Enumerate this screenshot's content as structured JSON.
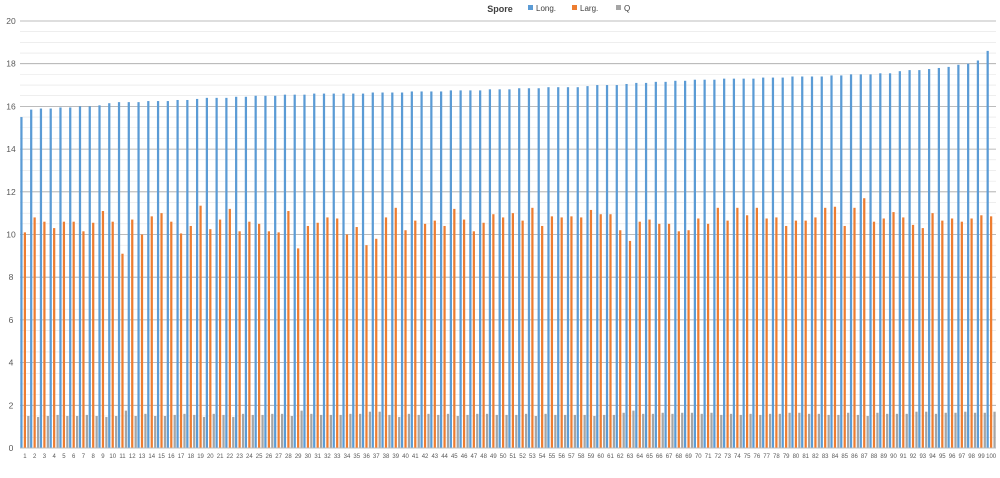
{
  "chart_data": {
    "type": "bar",
    "title": "Spore",
    "xlabel": "",
    "ylabel": "",
    "ylim": [
      0,
      20
    ],
    "yticks": [
      0,
      2,
      4,
      6,
      8,
      10,
      12,
      14,
      16,
      18,
      20
    ],
    "minor_grid_step": 0.5,
    "grid": true,
    "legend_position": "top",
    "categories": [
      "1",
      "2",
      "3",
      "4",
      "5",
      "6",
      "7",
      "8",
      "9",
      "10",
      "11",
      "12",
      "13",
      "14",
      "15",
      "16",
      "17",
      "18",
      "19",
      "20",
      "21",
      "22",
      "23",
      "24",
      "25",
      "26",
      "27",
      "28",
      "29",
      "30",
      "31",
      "32",
      "33",
      "34",
      "35",
      "36",
      "37",
      "38",
      "39",
      "40",
      "41",
      "42",
      "43",
      "44",
      "45",
      "46",
      "47",
      "48",
      "49",
      "50",
      "51",
      "52",
      "53",
      "54",
      "55",
      "56",
      "57",
      "58",
      "59",
      "60",
      "61",
      "62",
      "63",
      "64",
      "65",
      "66",
      "67",
      "68",
      "69",
      "70",
      "71",
      "72",
      "73",
      "74",
      "75",
      "76",
      "77",
      "78",
      "79",
      "80",
      "81",
      "82",
      "83",
      "84",
      "85",
      "86",
      "87",
      "88",
      "89",
      "90",
      "91",
      "92",
      "93",
      "94",
      "95",
      "96",
      "97",
      "98",
      "99",
      "100"
    ],
    "series": [
      {
        "name": "Long.",
        "color": "#5B9BD5",
        "values": [
          15.5,
          15.85,
          15.9,
          15.9,
          15.95,
          15.95,
          16.0,
          16.0,
          16.05,
          16.15,
          16.2,
          16.2,
          16.2,
          16.25,
          16.25,
          16.25,
          16.3,
          16.3,
          16.35,
          16.4,
          16.4,
          16.4,
          16.45,
          16.45,
          16.5,
          16.5,
          16.5,
          16.55,
          16.55,
          16.55,
          16.6,
          16.6,
          16.6,
          16.6,
          16.6,
          16.6,
          16.65,
          16.65,
          16.65,
          16.65,
          16.7,
          16.7,
          16.7,
          16.7,
          16.75,
          16.75,
          16.75,
          16.75,
          16.8,
          16.8,
          16.8,
          16.85,
          16.85,
          16.85,
          16.9,
          16.9,
          16.9,
          16.9,
          16.95,
          17.0,
          17.0,
          17.0,
          17.05,
          17.1,
          17.1,
          17.15,
          17.15,
          17.2,
          17.2,
          17.25,
          17.25,
          17.25,
          17.3,
          17.3,
          17.3,
          17.3,
          17.35,
          17.35,
          17.35,
          17.4,
          17.4,
          17.4,
          17.4,
          17.45,
          17.45,
          17.5,
          17.5,
          17.5,
          17.55,
          17.55,
          17.65,
          17.7,
          17.7,
          17.75,
          17.8,
          17.85,
          17.95,
          18.0,
          18.15,
          18.6
        ]
      },
      {
        "name": "Larg.",
        "color": "#ED7D31",
        "values": [
          10.1,
          10.8,
          10.6,
          10.3,
          10.6,
          10.6,
          10.15,
          10.55,
          11.1,
          10.6,
          9.1,
          10.7,
          10.0,
          10.85,
          11.0,
          10.6,
          10.05,
          10.4,
          11.35,
          10.25,
          10.7,
          11.2,
          10.15,
          10.6,
          10.5,
          10.15,
          10.1,
          11.1,
          9.35,
          10.4,
          10.55,
          10.8,
          10.75,
          10.0,
          10.35,
          9.5,
          9.8,
          10.8,
          11.25,
          10.2,
          10.65,
          10.5,
          10.65,
          10.4,
          11.2,
          10.7,
          10.15,
          10.55,
          10.95,
          10.8,
          11.0,
          10.65,
          11.25,
          10.4,
          10.85,
          10.8,
          10.85,
          10.8,
          11.15,
          10.95,
          10.95,
          10.2,
          9.7,
          10.6,
          10.7,
          10.5,
          10.5,
          10.15,
          10.2,
          10.75,
          10.5,
          11.25,
          10.65,
          11.25,
          10.9,
          11.25,
          10.75,
          10.8,
          10.4,
          10.65,
          10.65,
          10.8,
          11.25,
          11.3,
          10.4,
          11.25,
          11.7,
          10.6,
          10.75,
          11.05,
          10.8,
          10.45,
          10.3,
          11.0,
          10.65,
          10.75,
          10.6,
          10.75,
          10.9,
          10.85
        ]
      },
      {
        "name": "Q",
        "color": "#A5A5A5",
        "values": [
          1.5,
          1.45,
          1.5,
          1.55,
          1.5,
          1.5,
          1.55,
          1.5,
          1.45,
          1.5,
          1.75,
          1.5,
          1.6,
          1.5,
          1.5,
          1.55,
          1.6,
          1.55,
          1.45,
          1.6,
          1.55,
          1.45,
          1.6,
          1.55,
          1.55,
          1.6,
          1.6,
          1.5,
          1.75,
          1.6,
          1.55,
          1.55,
          1.55,
          1.6,
          1.6,
          1.7,
          1.7,
          1.55,
          1.45,
          1.6,
          1.55,
          1.6,
          1.55,
          1.6,
          1.5,
          1.55,
          1.6,
          1.6,
          1.55,
          1.55,
          1.55,
          1.6,
          1.5,
          1.6,
          1.55,
          1.55,
          1.55,
          1.55,
          1.5,
          1.55,
          1.55,
          1.65,
          1.75,
          1.6,
          1.6,
          1.65,
          1.6,
          1.65,
          1.65,
          1.6,
          1.65,
          1.55,
          1.6,
          1.55,
          1.6,
          1.55,
          1.6,
          1.6,
          1.65,
          1.65,
          1.6,
          1.6,
          1.55,
          1.55,
          1.65,
          1.55,
          1.5,
          1.65,
          1.6,
          1.6,
          1.6,
          1.7,
          1.7,
          1.6,
          1.65,
          1.65,
          1.7,
          1.65,
          1.65,
          1.7
        ]
      }
    ]
  }
}
